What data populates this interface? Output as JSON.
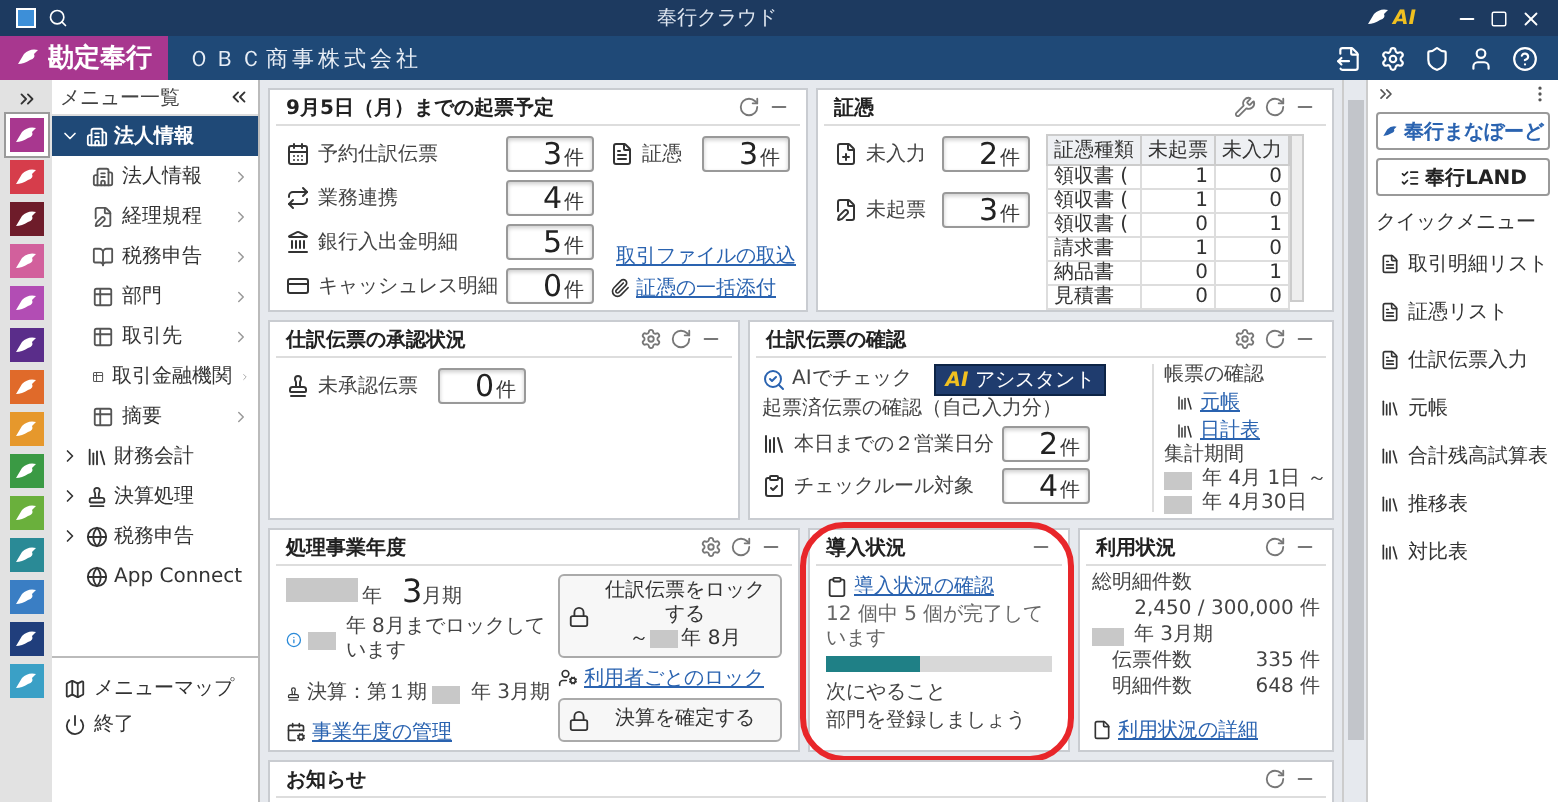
{
  "window": {
    "title": "奉行クラウド",
    "ai_badge": "AI"
  },
  "header": {
    "product": "勘定奉行",
    "company": "ＯＢＣ商事株式会社"
  },
  "launcher": [
    {
      "color": "#a8378f",
      "selected": true
    },
    {
      "color": "#d63d4b",
      "selected": false
    },
    {
      "color": "#6e1c2a",
      "selected": false
    },
    {
      "color": "#d2609c",
      "selected": false
    },
    {
      "color": "#b24db4",
      "selected": false
    },
    {
      "color": "#5a2d8a",
      "selected": false
    },
    {
      "color": "#e06a2a",
      "selected": false
    },
    {
      "color": "#e6982c",
      "selected": false
    },
    {
      "color": "#3a9a44",
      "selected": false
    },
    {
      "color": "#6ab03c",
      "selected": false
    },
    {
      "color": "#2a8a96",
      "selected": false
    },
    {
      "color": "#3a7ec4",
      "selected": false
    },
    {
      "color": "#203e7c",
      "selected": false
    },
    {
      "color": "#3aa0c6",
      "selected": false
    }
  ],
  "menu": {
    "title": "メニュー一覧",
    "items": [
      {
        "label": "法人情報",
        "expanded": true,
        "selected": true,
        "children": [
          {
            "label": "法人情報",
            "selected": false
          },
          {
            "label": "経理規程",
            "selected": false
          },
          {
            "label": "税務申告",
            "selected": false
          },
          {
            "label": "部門",
            "selected": false
          },
          {
            "label": "取引先",
            "selected": false
          },
          {
            "label": "取引金融機関",
            "selected": false
          },
          {
            "label": "摘要",
            "selected": false
          }
        ]
      },
      {
        "label": "財務会計",
        "expanded": false,
        "selected": false
      },
      {
        "label": "決算処理",
        "expanded": false,
        "selected": false
      },
      {
        "label": "税務申告",
        "expanded": false,
        "selected": false
      },
      {
        "label": "App Connect",
        "selected": false
      }
    ],
    "footer": [
      {
        "label": "メニューマップ"
      },
      {
        "label": "終了"
      }
    ]
  },
  "schedule": {
    "title": "9月5日（月）までの起票予定",
    "counters": [
      {
        "label": "予約仕訳伝票",
        "value": "3",
        "unit": "件"
      },
      {
        "label": "業務連携",
        "value": "4",
        "unit": "件"
      },
      {
        "label": "銀行入出金明細",
        "value": "5",
        "unit": "件"
      },
      {
        "label": "キャッシュレス明細",
        "value": "0",
        "unit": "件"
      }
    ],
    "voucher": {
      "label": "証憑",
      "value": "3",
      "unit": "件"
    },
    "links": [
      "取引ファイルの取込",
      "証憑の一括添付"
    ]
  },
  "vouchers": {
    "title": "証憑",
    "counters": [
      {
        "label": "未入力",
        "value": "2",
        "unit": "件"
      },
      {
        "label": "未起票",
        "value": "3",
        "unit": "件"
      }
    ],
    "table": {
      "columns": [
        "証憑種類",
        "未起票",
        "未入力"
      ],
      "rows": [
        [
          "領収書 (",
          "1",
          "0"
        ],
        [
          "領収書 (",
          "1",
          "0"
        ],
        [
          "領収書 (",
          "0",
          "1"
        ],
        [
          "請求書",
          "1",
          "0"
        ],
        [
          "納品書",
          "0",
          "1"
        ],
        [
          "見積書",
          "0",
          "0"
        ]
      ]
    }
  },
  "approval": {
    "title": "仕訳伝票の承認状況",
    "counter": {
      "label": "未承認伝票",
      "value": "0",
      "unit": "件"
    }
  },
  "check": {
    "title": "仕訳伝票の確認",
    "ai_check": "AIでチェック",
    "ai_button": {
      "badge": "AI",
      "label": "アシスタント"
    },
    "section": "起票済伝票の確認（自己入力分）",
    "counters": [
      {
        "label": "本日までの２営業日分",
        "value": "2",
        "unit": "件"
      },
      {
        "label": "チェックルール対象",
        "value": "4",
        "unit": "件"
      }
    ],
    "reports_title": "帳票の確認",
    "reports": [
      "元帳",
      "日計表"
    ],
    "period_title": "集計期間",
    "period_from": "年 4月 1日 ～",
    "period_to": "年 4月30日"
  },
  "fiscal": {
    "title": "処理事業年度",
    "year_suffix": "年",
    "period": "3",
    "period_unit": "月期",
    "lock_notice": "年 8月までロックしています",
    "closing": "決算：第１期",
    "closing_period": "年 3月期",
    "lock_button": {
      "label": "仕訳伝票をロックする",
      "sub_prefix": "～",
      "sub": "年 8月"
    },
    "user_lock_link": "利用者ごとのロック",
    "close_button": "決算を確定する",
    "manage_link": "事業年度の管理"
  },
  "onboarding": {
    "title": "導入状況",
    "highlighted": true,
    "link": "導入状況の確認",
    "progress_text": "12 個中 5 個が完了しています",
    "level": 0.42,
    "next_title": "次にやること",
    "next_task": "部門を登録しましょう"
  },
  "usage": {
    "title": "利用状況",
    "total_label": "総明細件数",
    "total": "2,450 / 300,000 件",
    "period": "年 3月期",
    "rows": [
      {
        "label": "伝票件数",
        "value": "335 件"
      },
      {
        "label": "明細件数",
        "value": "648 件"
      }
    ],
    "link": "利用状況の詳細"
  },
  "news": {
    "title": "お知らせ"
  },
  "right_panel": {
    "buttons": [
      "奉行まなぼーど",
      "奉行LAND"
    ],
    "quick_title": "クイックメニュー",
    "quick_items": [
      "取引明細リスト",
      "証憑リスト",
      "仕訳伝票入力",
      "元帳",
      "合計残高試算表",
      "推移表",
      "対比表"
    ]
  }
}
